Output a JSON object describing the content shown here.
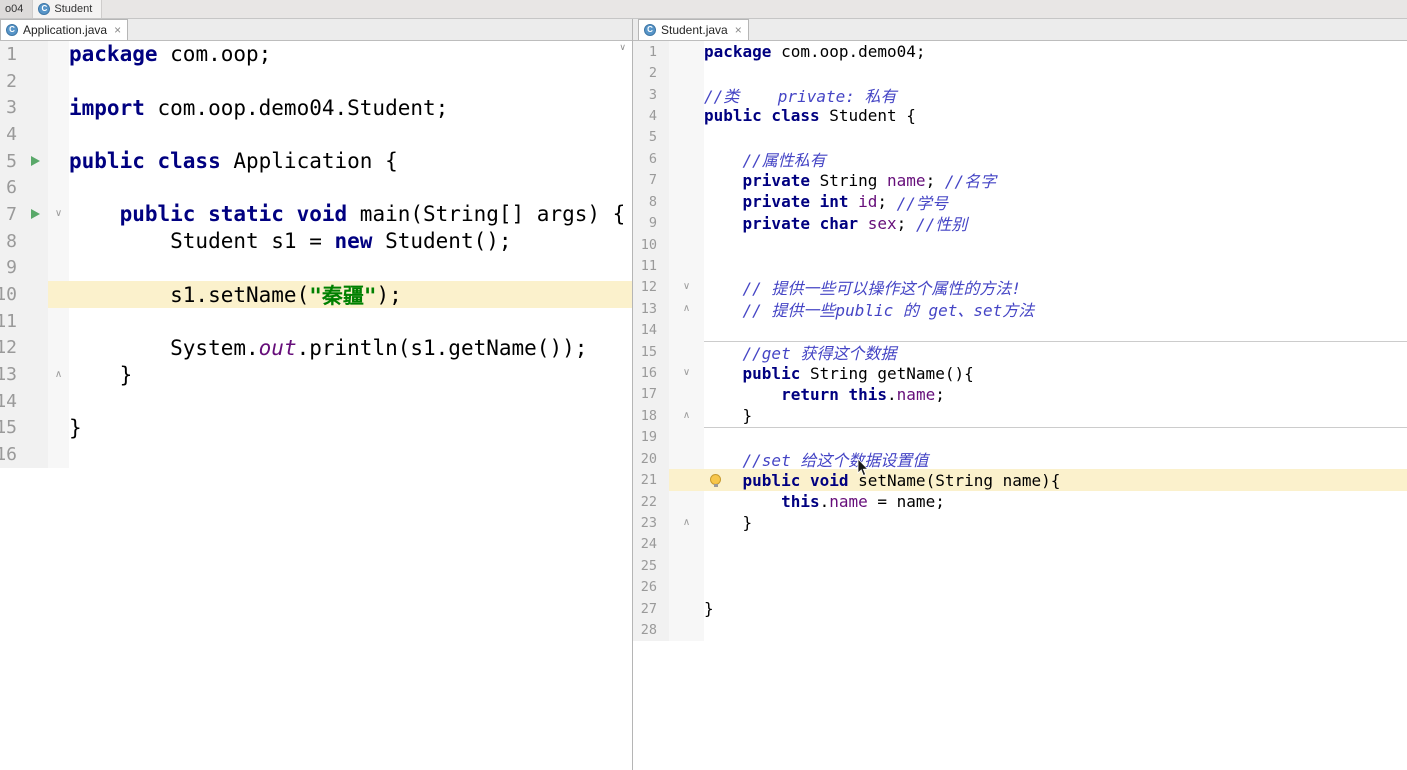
{
  "navbar": {
    "items": [
      {
        "label": "o04"
      },
      {
        "label": "Student",
        "icon_letter": "C"
      }
    ]
  },
  "tabs": {
    "left": {
      "label": "Application.java",
      "close": "×",
      "icon_letter": "C"
    },
    "right": {
      "label": "Student.java",
      "close": "×",
      "icon_letter": "C"
    }
  },
  "glyphs": {
    "fold_down": "∨",
    "fold_up": "∧",
    "scroll_arrow": "∨"
  },
  "colors": {
    "keyword": "#000080",
    "string": "#008000",
    "comment": "#4545C5",
    "field": "#660E7A",
    "current_line_highlight": "#FBF1CC",
    "run_icon_green": "#59A869",
    "bulb_yellow": "#F7C64A"
  },
  "left_pane": {
    "lines": [
      {
        "n": 1,
        "tokens": [
          [
            "kw",
            "package"
          ],
          [
            "pl",
            " com.oop;"
          ]
        ]
      },
      {
        "n": 2,
        "tokens": []
      },
      {
        "n": 3,
        "tokens": [
          [
            "kw",
            "import"
          ],
          [
            "pl",
            " com.oop.demo04.Student;"
          ]
        ]
      },
      {
        "n": 4,
        "tokens": []
      },
      {
        "n": 5,
        "run": true,
        "tokens": [
          [
            "kw",
            "public class"
          ],
          [
            "pl",
            " Application {"
          ]
        ]
      },
      {
        "n": 6,
        "tokens": []
      },
      {
        "n": 7,
        "run": true,
        "fold": "down",
        "tokens": [
          [
            "pl",
            "    "
          ],
          [
            "kw",
            "public static void"
          ],
          [
            "pl",
            " main(String[] args) {"
          ]
        ]
      },
      {
        "n": 8,
        "tokens": [
          [
            "pl",
            "        Student s1 = "
          ],
          [
            "kw",
            "new"
          ],
          [
            "pl",
            " Student();"
          ]
        ]
      },
      {
        "n": 9,
        "tokens": []
      },
      {
        "n": 10,
        "hl": true,
        "tokens": [
          [
            "pl",
            "        s1.setName("
          ],
          [
            "str",
            "\"秦疆\""
          ],
          [
            "pl",
            ");"
          ]
        ]
      },
      {
        "n": 11,
        "tokens": []
      },
      {
        "n": 12,
        "tokens": [
          [
            "pl",
            "        System."
          ],
          [
            "sf",
            "out"
          ],
          [
            "pl",
            ".println(s1.getName());"
          ]
        ]
      },
      {
        "n": 13,
        "fold": "up",
        "tokens": [
          [
            "pl",
            "    }"
          ]
        ]
      },
      {
        "n": 14,
        "tokens": []
      },
      {
        "n": 15,
        "tokens": [
          [
            "pl",
            "}"
          ]
        ]
      },
      {
        "n": 16,
        "tokens": []
      }
    ]
  },
  "right_pane": {
    "separators_before": [
      15,
      19
    ],
    "lines": [
      {
        "n": 1,
        "tokens": [
          [
            "kw",
            "package"
          ],
          [
            "pl",
            " com.oop.demo04;"
          ]
        ]
      },
      {
        "n": 2,
        "tokens": []
      },
      {
        "n": 3,
        "tokens": [
          [
            "cm",
            "//类    private: 私有"
          ]
        ]
      },
      {
        "n": 4,
        "tokens": [
          [
            "kw",
            "public class"
          ],
          [
            "pl",
            " Student {"
          ]
        ]
      },
      {
        "n": 5,
        "tokens": []
      },
      {
        "n": 6,
        "tokens": [
          [
            "pl",
            "    "
          ],
          [
            "cm",
            "//属性私有"
          ]
        ]
      },
      {
        "n": 7,
        "tokens": [
          [
            "pl",
            "    "
          ],
          [
            "kw",
            "private"
          ],
          [
            "pl",
            " String "
          ],
          [
            "fld",
            "name"
          ],
          [
            "pl",
            "; "
          ],
          [
            "cm",
            "//名字"
          ]
        ]
      },
      {
        "n": 8,
        "tokens": [
          [
            "pl",
            "    "
          ],
          [
            "kw",
            "private int"
          ],
          [
            "pl",
            " "
          ],
          [
            "fld",
            "id"
          ],
          [
            "pl",
            "; "
          ],
          [
            "cm",
            "//学号"
          ]
        ]
      },
      {
        "n": 9,
        "tokens": [
          [
            "pl",
            "    "
          ],
          [
            "kw",
            "private char"
          ],
          [
            "pl",
            " "
          ],
          [
            "fld",
            "sex"
          ],
          [
            "pl",
            "; "
          ],
          [
            "cm",
            "//性别"
          ]
        ]
      },
      {
        "n": 10,
        "tokens": []
      },
      {
        "n": 11,
        "tokens": []
      },
      {
        "n": 12,
        "fold": "down",
        "tokens": [
          [
            "pl",
            "    "
          ],
          [
            "cm",
            "// 提供一些可以操作这个属性的方法!"
          ]
        ]
      },
      {
        "n": 13,
        "fold": "up",
        "tokens": [
          [
            "pl",
            "    "
          ],
          [
            "cm",
            "// 提供一些public 的 get、set方法"
          ]
        ]
      },
      {
        "n": 14,
        "tokens": []
      },
      {
        "n": 15,
        "tokens": [
          [
            "pl",
            "    "
          ],
          [
            "cm",
            "//get 获得这个数据"
          ]
        ]
      },
      {
        "n": 16,
        "fold": "down",
        "tokens": [
          [
            "pl",
            "    "
          ],
          [
            "kw",
            "public"
          ],
          [
            "pl",
            " String getName(){"
          ]
        ]
      },
      {
        "n": 17,
        "tokens": [
          [
            "pl",
            "        "
          ],
          [
            "kw",
            "return this"
          ],
          [
            "pl",
            "."
          ],
          [
            "fld",
            "name"
          ],
          [
            "pl",
            ";"
          ]
        ]
      },
      {
        "n": 18,
        "fold": "up",
        "tokens": [
          [
            "pl",
            "    }"
          ]
        ]
      },
      {
        "n": 19,
        "tokens": []
      },
      {
        "n": 20,
        "tokens": [
          [
            "pl",
            "    "
          ],
          [
            "cm",
            "//set 给这个数据设置值"
          ]
        ]
      },
      {
        "n": 21,
        "hl": true,
        "bulb": true,
        "tokens": [
          [
            "pl",
            "    "
          ],
          [
            "kw",
            "public void"
          ],
          [
            "pl",
            " setName(String name){"
          ]
        ]
      },
      {
        "n": 22,
        "tokens": [
          [
            "pl",
            "        "
          ],
          [
            "kw",
            "this"
          ],
          [
            "pl",
            "."
          ],
          [
            "fld",
            "name"
          ],
          [
            "pl",
            " = name;"
          ]
        ]
      },
      {
        "n": 23,
        "fold": "up",
        "tokens": [
          [
            "pl",
            "    }"
          ]
        ]
      },
      {
        "n": 24,
        "tokens": []
      },
      {
        "n": 25,
        "tokens": []
      },
      {
        "n": 26,
        "tokens": []
      },
      {
        "n": 27,
        "tokens": [
          [
            "pl",
            "}"
          ]
        ]
      },
      {
        "n": 28,
        "tokens": []
      }
    ]
  }
}
